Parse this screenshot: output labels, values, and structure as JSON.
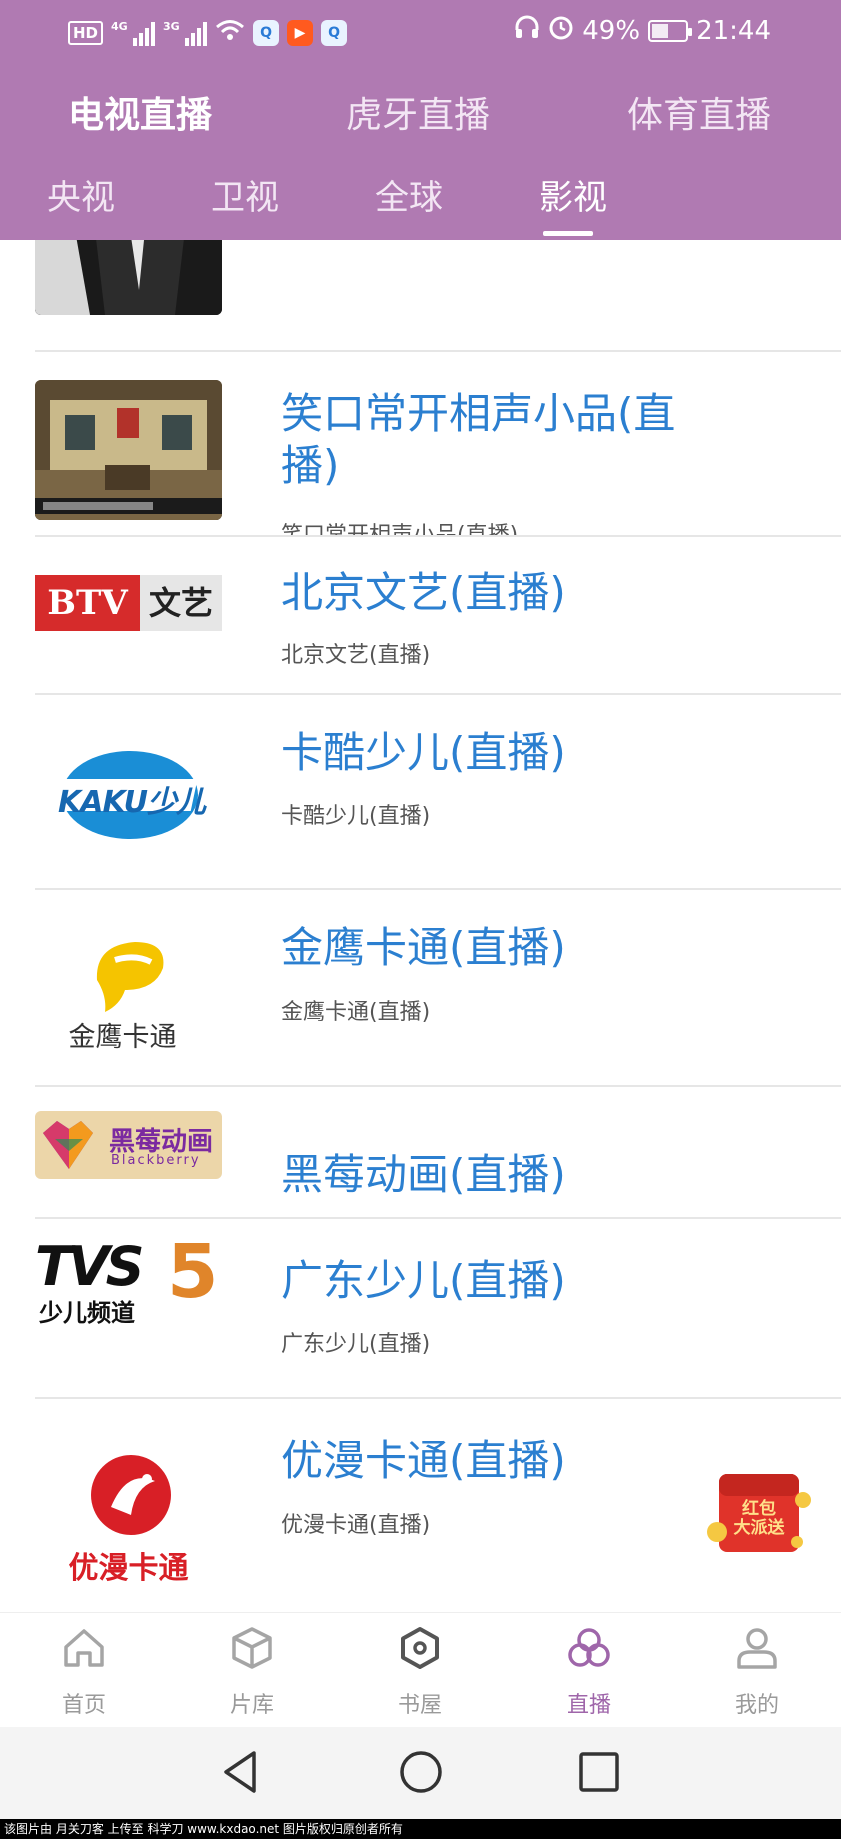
{
  "status_bar": {
    "network": "4G",
    "network2": "3G",
    "battery": "49%",
    "battery_level": 0.49,
    "time": "21:44"
  },
  "top_tabs": [
    {
      "label": "电视直播",
      "active": true
    },
    {
      "label": "虎牙直播",
      "active": false
    },
    {
      "label": "体育直播",
      "active": false
    }
  ],
  "sub_tabs": [
    {
      "label": "央视",
      "active": false
    },
    {
      "label": "卫视",
      "active": false
    },
    {
      "label": "全球",
      "active": false
    },
    {
      "label": "影视",
      "active": true
    }
  ],
  "channels": [
    {
      "title": "",
      "subtitle": "",
      "logo": "person-photo"
    },
    {
      "title_line1": "笑口常开相声小品(直",
      "title_line2": "播)",
      "subtitle": "笑口常开相声小品(直播)",
      "logo": "stage-photo"
    },
    {
      "title": "北京文艺(直播)",
      "subtitle": "北京文艺(直播)",
      "logo_text1": "BTV",
      "logo_text2": "文艺"
    },
    {
      "title": "卡酷少儿(直播)",
      "subtitle": "卡酷少儿(直播)",
      "logo_text": "KAKU少儿"
    },
    {
      "title": "金鹰卡通(直播)",
      "subtitle": "金鹰卡通(直播)",
      "logo_text": "金鹰卡通"
    },
    {
      "title": "黑莓动画(直播)",
      "subtitle": "",
      "logo_text1": "黑莓动画",
      "logo_text2": "Blackberry"
    },
    {
      "title": "广东少儿(直播)",
      "subtitle": "广东少儿(直播)",
      "logo_text1": "TVS",
      "logo_text2": "5",
      "logo_text3": "少儿频道"
    },
    {
      "title": "优漫卡通(直播)",
      "subtitle": "优漫卡通(直播)",
      "logo_text": "优漫卡通"
    }
  ],
  "red_packet": {
    "line1": "红包",
    "line2": "大派送"
  },
  "bottom_nav": [
    {
      "label": "首页",
      "icon": "home-icon",
      "active": false
    },
    {
      "label": "片库",
      "icon": "cube-icon",
      "active": false
    },
    {
      "label": "书屋",
      "icon": "hexagon-icon",
      "active": false
    },
    {
      "label": "直播",
      "icon": "circles-icon",
      "active": true
    },
    {
      "label": "我的",
      "icon": "user-icon",
      "active": false
    }
  ],
  "watermark": "该图片由 月关刀客 上传至 科学刀 www.kxdao.net 图片版权归原创者所有",
  "colors": {
    "header": "#b07ab2",
    "title_blue": "#2b7fd0",
    "nav_active": "#9f66aa"
  }
}
